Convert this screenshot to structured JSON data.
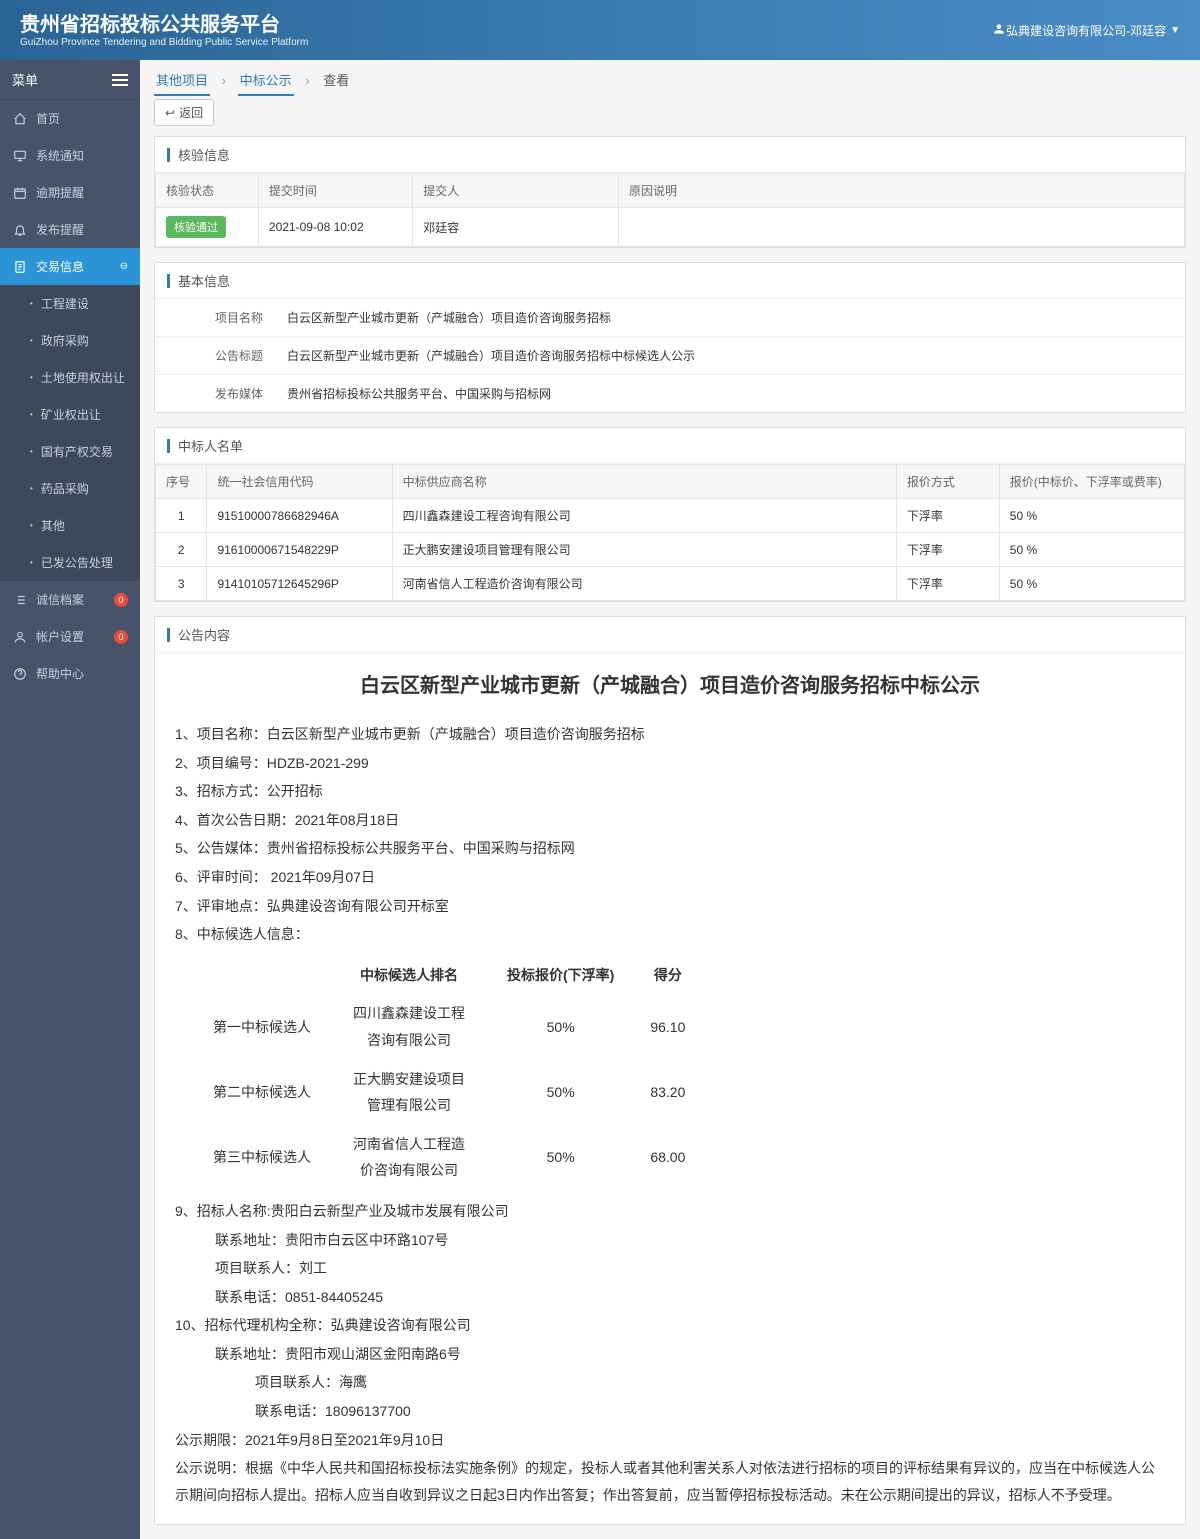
{
  "header": {
    "title": "贵州省招标投标公共服务平台",
    "subtitle": "GuiZhou Province Tendering and Bidding Public Service Platform",
    "user": "弘典建设咨询有限公司-邓廷容"
  },
  "sidebar": {
    "menu_label": "菜单",
    "items": [
      {
        "label": "首页",
        "icon": "home"
      },
      {
        "label": "系统通知",
        "icon": "monitor"
      },
      {
        "label": "逾期提醒",
        "icon": "calendar"
      },
      {
        "label": "发布提醒",
        "icon": "bell"
      },
      {
        "label": "交易信息",
        "icon": "doc",
        "active": true,
        "expand": true
      },
      {
        "label": "诚信档案",
        "icon": "list",
        "badge": "0"
      },
      {
        "label": "帐户设置",
        "icon": "user",
        "badge": "0"
      },
      {
        "label": "帮助中心",
        "icon": "help"
      }
    ],
    "submenu": [
      {
        "label": "工程建设"
      },
      {
        "label": "政府采购"
      },
      {
        "label": "土地使用权出让"
      },
      {
        "label": "矿业权出让"
      },
      {
        "label": "国有产权交易"
      },
      {
        "label": "药品采购"
      },
      {
        "label": "其他"
      },
      {
        "label": "已发公告处理"
      }
    ]
  },
  "breadcrumb": {
    "a": "其他项目",
    "b": "中标公示",
    "c": "查看"
  },
  "back_label": "返回",
  "panel_verify": {
    "title": "核验信息",
    "headers": {
      "status": "核验状态",
      "time": "提交时间",
      "submitter": "提交人",
      "reason": "原因说明"
    },
    "row": {
      "status": "核验通过",
      "time": "2021-09-08 10:02",
      "submitter": "邓廷容",
      "reason": ""
    }
  },
  "panel_basic": {
    "title": "基本信息",
    "rows": [
      {
        "label": "项目名称",
        "value": "白云区新型产业城市更新（产城融合）项目造价咨询服务招标"
      },
      {
        "label": "公告标题",
        "value": "白云区新型产业城市更新（产城融合）项目造价咨询服务招标中标候选人公示"
      },
      {
        "label": "发布媒体",
        "value": "贵州省招标投标公共服务平台、中国采购与招标网"
      }
    ]
  },
  "panel_winners": {
    "title": "中标人名单",
    "headers": {
      "seq": "序号",
      "code": "统一社会信用代码",
      "name": "中标供应商名称",
      "method": "报价方式",
      "price": "报价(中标价、下浮率或费率)"
    },
    "rows": [
      {
        "seq": "1",
        "code": "91510000786682946A",
        "name": "四川鑫森建设工程咨询有限公司",
        "method": "下浮率",
        "price": "50 %"
      },
      {
        "seq": "2",
        "code": "91610000671548229P",
        "name": "正大鹏安建设项目管理有限公司",
        "method": "下浮率",
        "price": "50 %"
      },
      {
        "seq": "3",
        "code": "91410105712645296P",
        "name": "河南省信人工程造价咨询有限公司",
        "method": "下浮率",
        "price": "50 %"
      }
    ]
  },
  "panel_content": {
    "title": "公告内容",
    "doc_title": "白云区新型产业城市更新（产城融合）项目造价咨询服务招标中标公示",
    "p1": "1、项目名称：白云区新型产业城市更新（产城融合）项目造价咨询服务招标",
    "p2": "2、项目编号：HDZB-2021-299",
    "p3": "3、招标方式：公开招标",
    "p4": "4、首次公告日期：2021年08月18日",
    "p5": "5、公告媒体：贵州省招标投标公共服务平台、中国采购与招标网",
    "p6": "6、评审时间：  2021年09月07日",
    "p7": "7、评审地点：弘典建设咨询有限公司开标室",
    "p8": "8、中标候选人信息：",
    "ct": {
      "h1": "中标候选人排名",
      "h2": "投标报价(下浮率)",
      "h3": "得分",
      "r1a": "第一中标候选人",
      "r1b": "四川鑫森建设工程咨询有限公司",
      "r1c": "50%",
      "r1d": "96.10",
      "r2a": "第二中标候选人",
      "r2b": "正大鹏安建设项目管理有限公司",
      "r2c": "50%",
      "r2d": "83.20",
      "r3a": "第三中标候选人",
      "r3b": "河南省信人工程造价咨询有限公司",
      "r3c": "50%",
      "r3d": "68.00"
    },
    "p9a": "9、招标人名称:贵阳白云新型产业及城市发展有限公司",
    "p9b": "联系地址：贵阳市白云区中环路107号",
    "p9c": "项目联系人：刘工",
    "p9d": "联系电话：0851-84405245",
    "p10a": "10、招标代理机构全称：弘典建设咨询有限公司",
    "p10b": "联系地址：贵阳市观山湖区金阳南路6号",
    "p10c": "项目联系人：海鹰",
    "p10d": "联系电话：18096137700",
    "p11": "公示期限：2021年9月8日至2021年9月10日",
    "p12": "公示说明：根据《中华人民共和国招标投标法实施条例》的规定，投标人或者其他利害关系人对依法进行招标的项目的评标结果有异议的，应当在中标候选人公示期间向招标人提出。招标人应当自收到异议之日起3日内作出答复；作出答复前，应当暂停招标投标活动。未在公示期间提出的异议，招标人不予受理。"
  }
}
